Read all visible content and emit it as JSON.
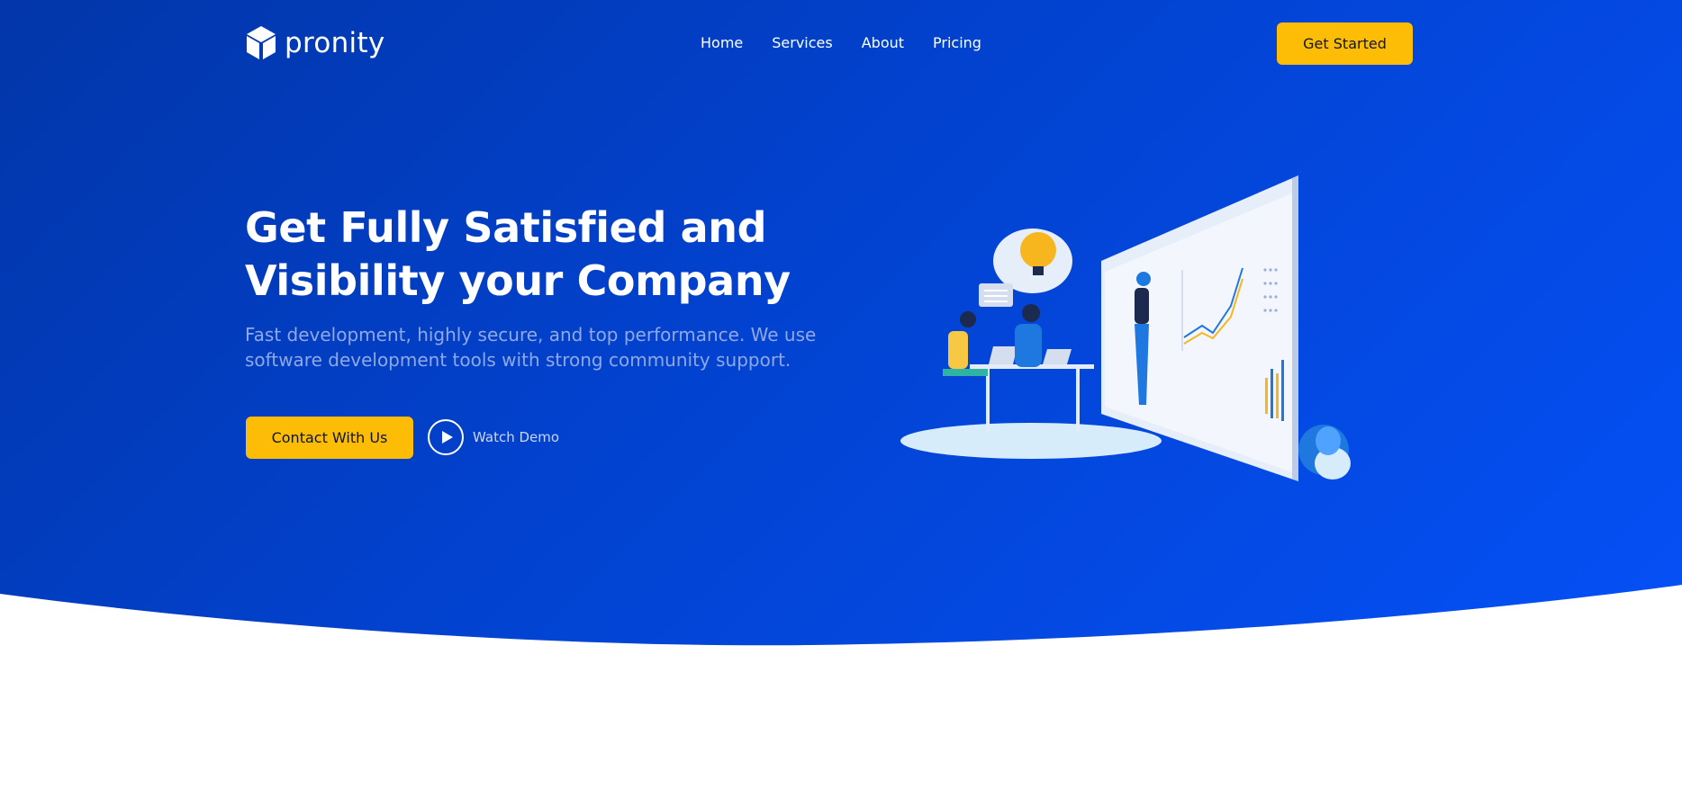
{
  "brand": {
    "name": "pronity",
    "logo_icon": "cube-icon"
  },
  "nav": {
    "items": [
      {
        "label": "Home"
      },
      {
        "label": "Services"
      },
      {
        "label": "About"
      },
      {
        "label": "Pricing"
      }
    ]
  },
  "header": {
    "cta_label": "Get Started"
  },
  "hero": {
    "headline_line1": "Get Fully Satisfied and",
    "headline_line2": "Visibility your Company",
    "subtext_line1": "Fast development, highly secure, and top performance. We use",
    "subtext_line2": "software development tools with strong community support.",
    "contact_label": "Contact With Us",
    "watch_label": "Watch Demo",
    "watch_icon": "play-icon"
  },
  "colors": {
    "hero_start": "#0236a9",
    "hero_end": "#0550f6",
    "accent_yellow": "#fdbc05",
    "background": "#ffffff"
  }
}
